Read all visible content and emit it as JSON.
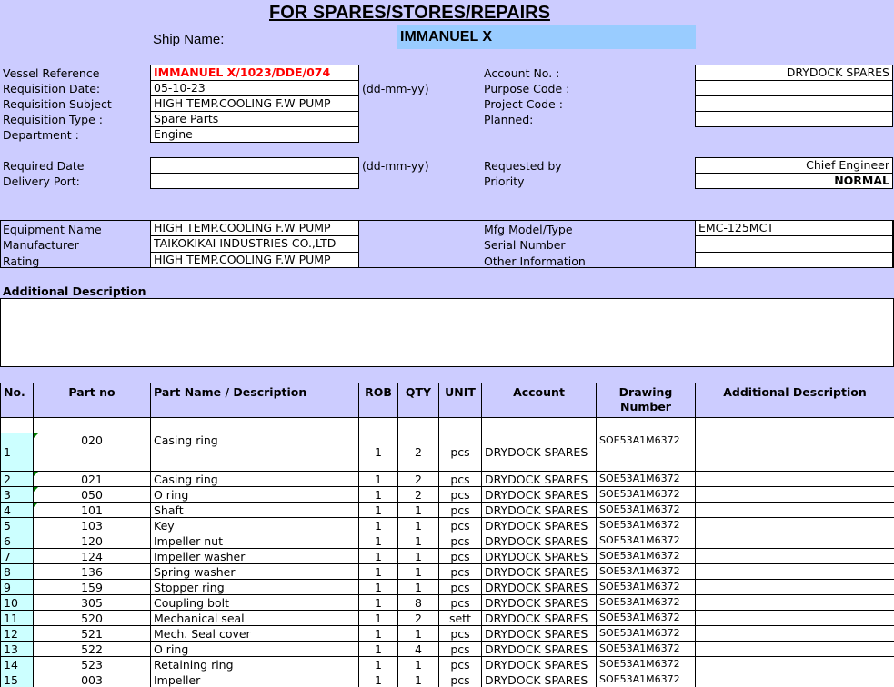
{
  "header": {
    "title": "FOR SPARES/STORES/REPAIRS",
    "ship_name_label": "Ship Name:",
    "ship_name": "IMMANUEL X"
  },
  "requisition": {
    "vessel_reference_label": "Vessel Reference",
    "vessel_reference": "IMMANUEL X/1023/DDE/074",
    "requisition_date_label": "Requisition Date:",
    "requisition_date": "05-10-23",
    "date_format_hint": "(dd-mm-yy)",
    "requisition_subject_label": "Requisition Subject",
    "requisition_subject": "HIGH TEMP.COOLING F.W PUMP",
    "requisition_type_label": "Requisition Type :",
    "requisition_type": "Spare Parts",
    "department_label": "Department :",
    "department": "Engine",
    "account_no_label": "Account No. :",
    "account_no": "DRYDOCK SPARES",
    "purpose_code_label": "Purpose Code :",
    "purpose_code": "",
    "project_code_label": "Project Code :",
    "project_code": "",
    "planned_label": "Planned:",
    "planned": "",
    "required_date_label": "Required Date",
    "required_date": "",
    "required_date_hint": "(dd-mm-yy)",
    "delivery_port_label": "Delivery Port:",
    "delivery_port": "",
    "requested_by_label": "Requested by",
    "requested_by": "Chief Engineer",
    "priority_label": "Priority",
    "priority": "NORMAL"
  },
  "equipment": {
    "equipment_name_label": "Equipment Name",
    "equipment_name": "HIGH TEMP.COOLING F.W PUMP",
    "manufacturer_label": "Manufacturer",
    "manufacturer": "TAIKOKIKAI INDUSTRIES CO.,LTD",
    "rating_label": "Rating",
    "rating": "HIGH TEMP.COOLING F.W PUMP",
    "mfg_model_label": "Mfg Model/Type",
    "mfg_model": "EMC-125MCT",
    "serial_number_label": "Serial Number",
    "serial_number": "",
    "other_info_label": "Other Information",
    "other_info": ""
  },
  "additional_description_label": "Additional Description",
  "additional_description": "",
  "table": {
    "columns": [
      "No.",
      "Part no",
      "Part Name / Description",
      "ROB",
      "QTY",
      "UNIT",
      "Account",
      "Drawing Number",
      "Additional Description"
    ],
    "rows": [
      {
        "no": "1",
        "part_no": "020",
        "name": "Casing ring",
        "rob": "1",
        "qty": "2",
        "unit": "pcs",
        "account": "DRYDOCK SPARES",
        "drawing": "SOE53A1M6372",
        "desc": ""
      },
      {
        "no": "2",
        "part_no": "021",
        "name": "Casing ring",
        "rob": "1",
        "qty": "2",
        "unit": "pcs",
        "account": "DRYDOCK SPARES",
        "drawing": "SOE53A1M6372",
        "desc": ""
      },
      {
        "no": "3",
        "part_no": "050",
        "name": "O ring",
        "rob": "1",
        "qty": "2",
        "unit": "pcs",
        "account": "DRYDOCK SPARES",
        "drawing": "SOE53A1M6372",
        "desc": ""
      },
      {
        "no": "4",
        "part_no": "101",
        "name": "Shaft",
        "rob": "1",
        "qty": "1",
        "unit": "pcs",
        "account": "DRYDOCK SPARES",
        "drawing": "SOE53A1M6372",
        "desc": ""
      },
      {
        "no": "5",
        "part_no": "103",
        "name": "Key",
        "rob": "1",
        "qty": "1",
        "unit": "pcs",
        "account": "DRYDOCK SPARES",
        "drawing": "SOE53A1M6372",
        "desc": ""
      },
      {
        "no": "6",
        "part_no": "120",
        "name": "Impeller nut",
        "rob": "1",
        "qty": "1",
        "unit": "pcs",
        "account": "DRYDOCK SPARES",
        "drawing": "SOE53A1M6372",
        "desc": ""
      },
      {
        "no": "7",
        "part_no": "124",
        "name": "Impeller washer",
        "rob": "1",
        "qty": "1",
        "unit": "pcs",
        "account": "DRYDOCK SPARES",
        "drawing": "SOE53A1M6372",
        "desc": ""
      },
      {
        "no": "8",
        "part_no": "136",
        "name": "Spring washer",
        "rob": "1",
        "qty": "1",
        "unit": "pcs",
        "account": "DRYDOCK SPARES",
        "drawing": "SOE53A1M6372",
        "desc": ""
      },
      {
        "no": "9",
        "part_no": "159",
        "name": "Stopper ring",
        "rob": "1",
        "qty": "1",
        "unit": "pcs",
        "account": "DRYDOCK SPARES",
        "drawing": "SOE53A1M6372",
        "desc": ""
      },
      {
        "no": "10",
        "part_no": "305",
        "name": "Coupling bolt",
        "rob": "1",
        "qty": "8",
        "unit": "pcs",
        "account": "DRYDOCK SPARES",
        "drawing": "SOE53A1M6372",
        "desc": ""
      },
      {
        "no": "11",
        "part_no": "520",
        "name": "Mechanical seal",
        "rob": "1",
        "qty": "2",
        "unit": "sett",
        "account": "DRYDOCK SPARES",
        "drawing": "SOE53A1M6372",
        "desc": ""
      },
      {
        "no": "12",
        "part_no": "521",
        "name": "Mech. Seal cover",
        "rob": "1",
        "qty": "1",
        "unit": "pcs",
        "account": "DRYDOCK SPARES",
        "drawing": "SOE53A1M6372",
        "desc": ""
      },
      {
        "no": "13",
        "part_no": "522",
        "name": "O ring",
        "rob": "1",
        "qty": "4",
        "unit": "pcs",
        "account": "DRYDOCK SPARES",
        "drawing": "SOE53A1M6372",
        "desc": ""
      },
      {
        "no": "14",
        "part_no": "523",
        "name": "Retaining ring",
        "rob": "1",
        "qty": "1",
        "unit": "pcs",
        "account": "DRYDOCK SPARES",
        "drawing": "SOE53A1M6372",
        "desc": ""
      },
      {
        "no": "15",
        "part_no": "003",
        "name": "Impeller",
        "rob": "1",
        "qty": "1",
        "unit": "pcs",
        "account": "DRYDOCK SPARES",
        "drawing": "SOE53A1M6372",
        "desc": ""
      }
    ]
  },
  "colors": {
    "band": "#ccccff",
    "ship_name_bg": "#99ccff",
    "row_number_bg": "#ccffff",
    "vessel_reference_text": "#ff0000",
    "cell_flag": "#008000"
  }
}
